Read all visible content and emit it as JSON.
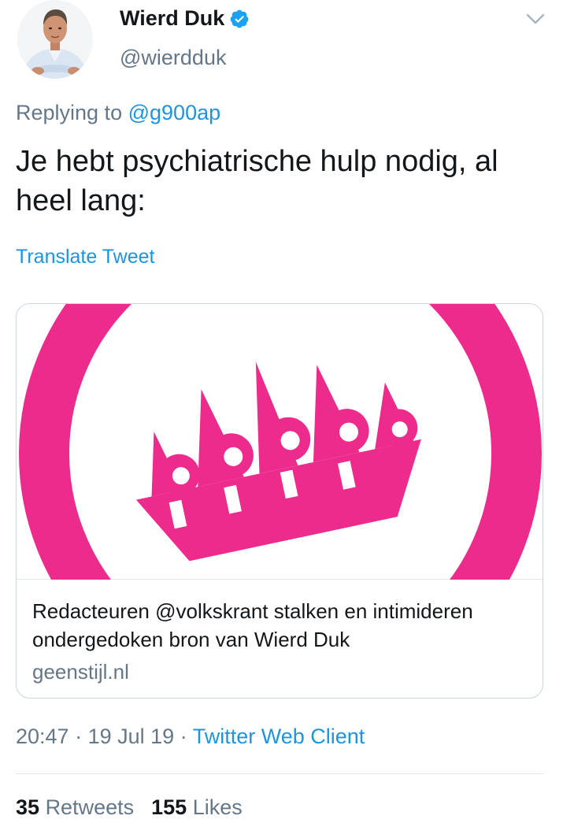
{
  "tweet": {
    "author": {
      "display_name": "Wierd Duk",
      "handle": "@wierdduk",
      "verified_icon": "verified-badge-icon"
    },
    "replying_prefix": "Replying to",
    "replying_to": "@g900ap",
    "text": "Je hebt psychiatrische hulp nodig, al heel lang:",
    "translate_label": "Translate Tweet",
    "card": {
      "title": "Redacteuren @volkskrant stalken en intimideren ondergedoken bron van Wierd Duk",
      "domain": "geenstijl.nl",
      "image_brand_color": "#ec2b8c"
    },
    "meta": {
      "time": "20:47",
      "sep1": " · ",
      "date": "19 Jul 19",
      "sep2": " · ",
      "client": "Twitter Web Client"
    },
    "stats": {
      "retweets_count": "35",
      "retweets_label": "Retweets",
      "likes_count": "155",
      "likes_label": "Likes"
    }
  },
  "colors": {
    "link": "#1b95e0",
    "secondary": "#657786",
    "primary": "#14171a",
    "verified": "#1da1f2"
  }
}
